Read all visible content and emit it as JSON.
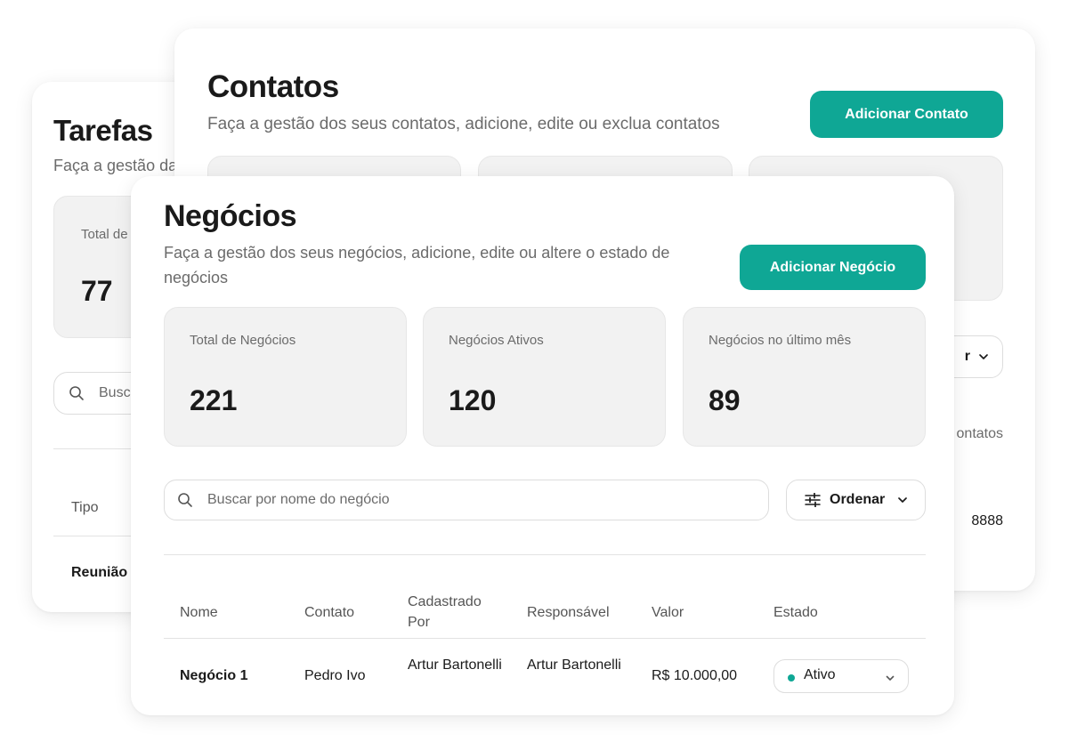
{
  "tarefas": {
    "title": "Tarefas",
    "subtitle": "Faça a gestão da",
    "stat_label": "Total de",
    "stat_value": "77",
    "search_placeholder": "Busca",
    "column_header": "Tipo",
    "row_value": "Reunião"
  },
  "contatos": {
    "title": "Contatos",
    "subtitle": "Faça a gestão dos seus contatos, adicione, edite ou exclua contatos",
    "add_button": "Adicionar Contato",
    "sort_partial": "r",
    "count_partial": "ontatos",
    "phone_partial": "8888"
  },
  "negocios": {
    "title": "Negócios",
    "subtitle": "Faça a gestão dos seus negócios, adicione, edite ou altere o estado de negócios",
    "add_button": "Adicionar Negócio",
    "stats": [
      {
        "label": "Total de Negócios",
        "value": "221"
      },
      {
        "label": "Negócios Ativos",
        "value": "120"
      },
      {
        "label": "Negócios no último mês",
        "value": "89"
      }
    ],
    "search": {
      "placeholder": "Buscar por nome do negócio",
      "value": ""
    },
    "sort_label": "Ordenar",
    "columns": [
      "Nome",
      "Contato",
      "Cadastrado Por",
      "Responsável",
      "Valor",
      "Estado"
    ],
    "rows": [
      {
        "nome": "Negócio 1",
        "contato": "Pedro Ivo",
        "cadastrado_por": "Artur Bartonelli",
        "responsavel": "Artur Bartonelli",
        "valor": "R$ 10.000,00",
        "estado": "Ativo"
      }
    ]
  },
  "colors": {
    "accent": "#0fa795",
    "stat_bg": "#f2f2f2",
    "muted_text": "#6b6b6b"
  },
  "icons": {
    "search": "search-icon",
    "sort": "sliders-icon",
    "dropdown": "chevron-down-icon",
    "status_dot": "status-dot-icon"
  }
}
